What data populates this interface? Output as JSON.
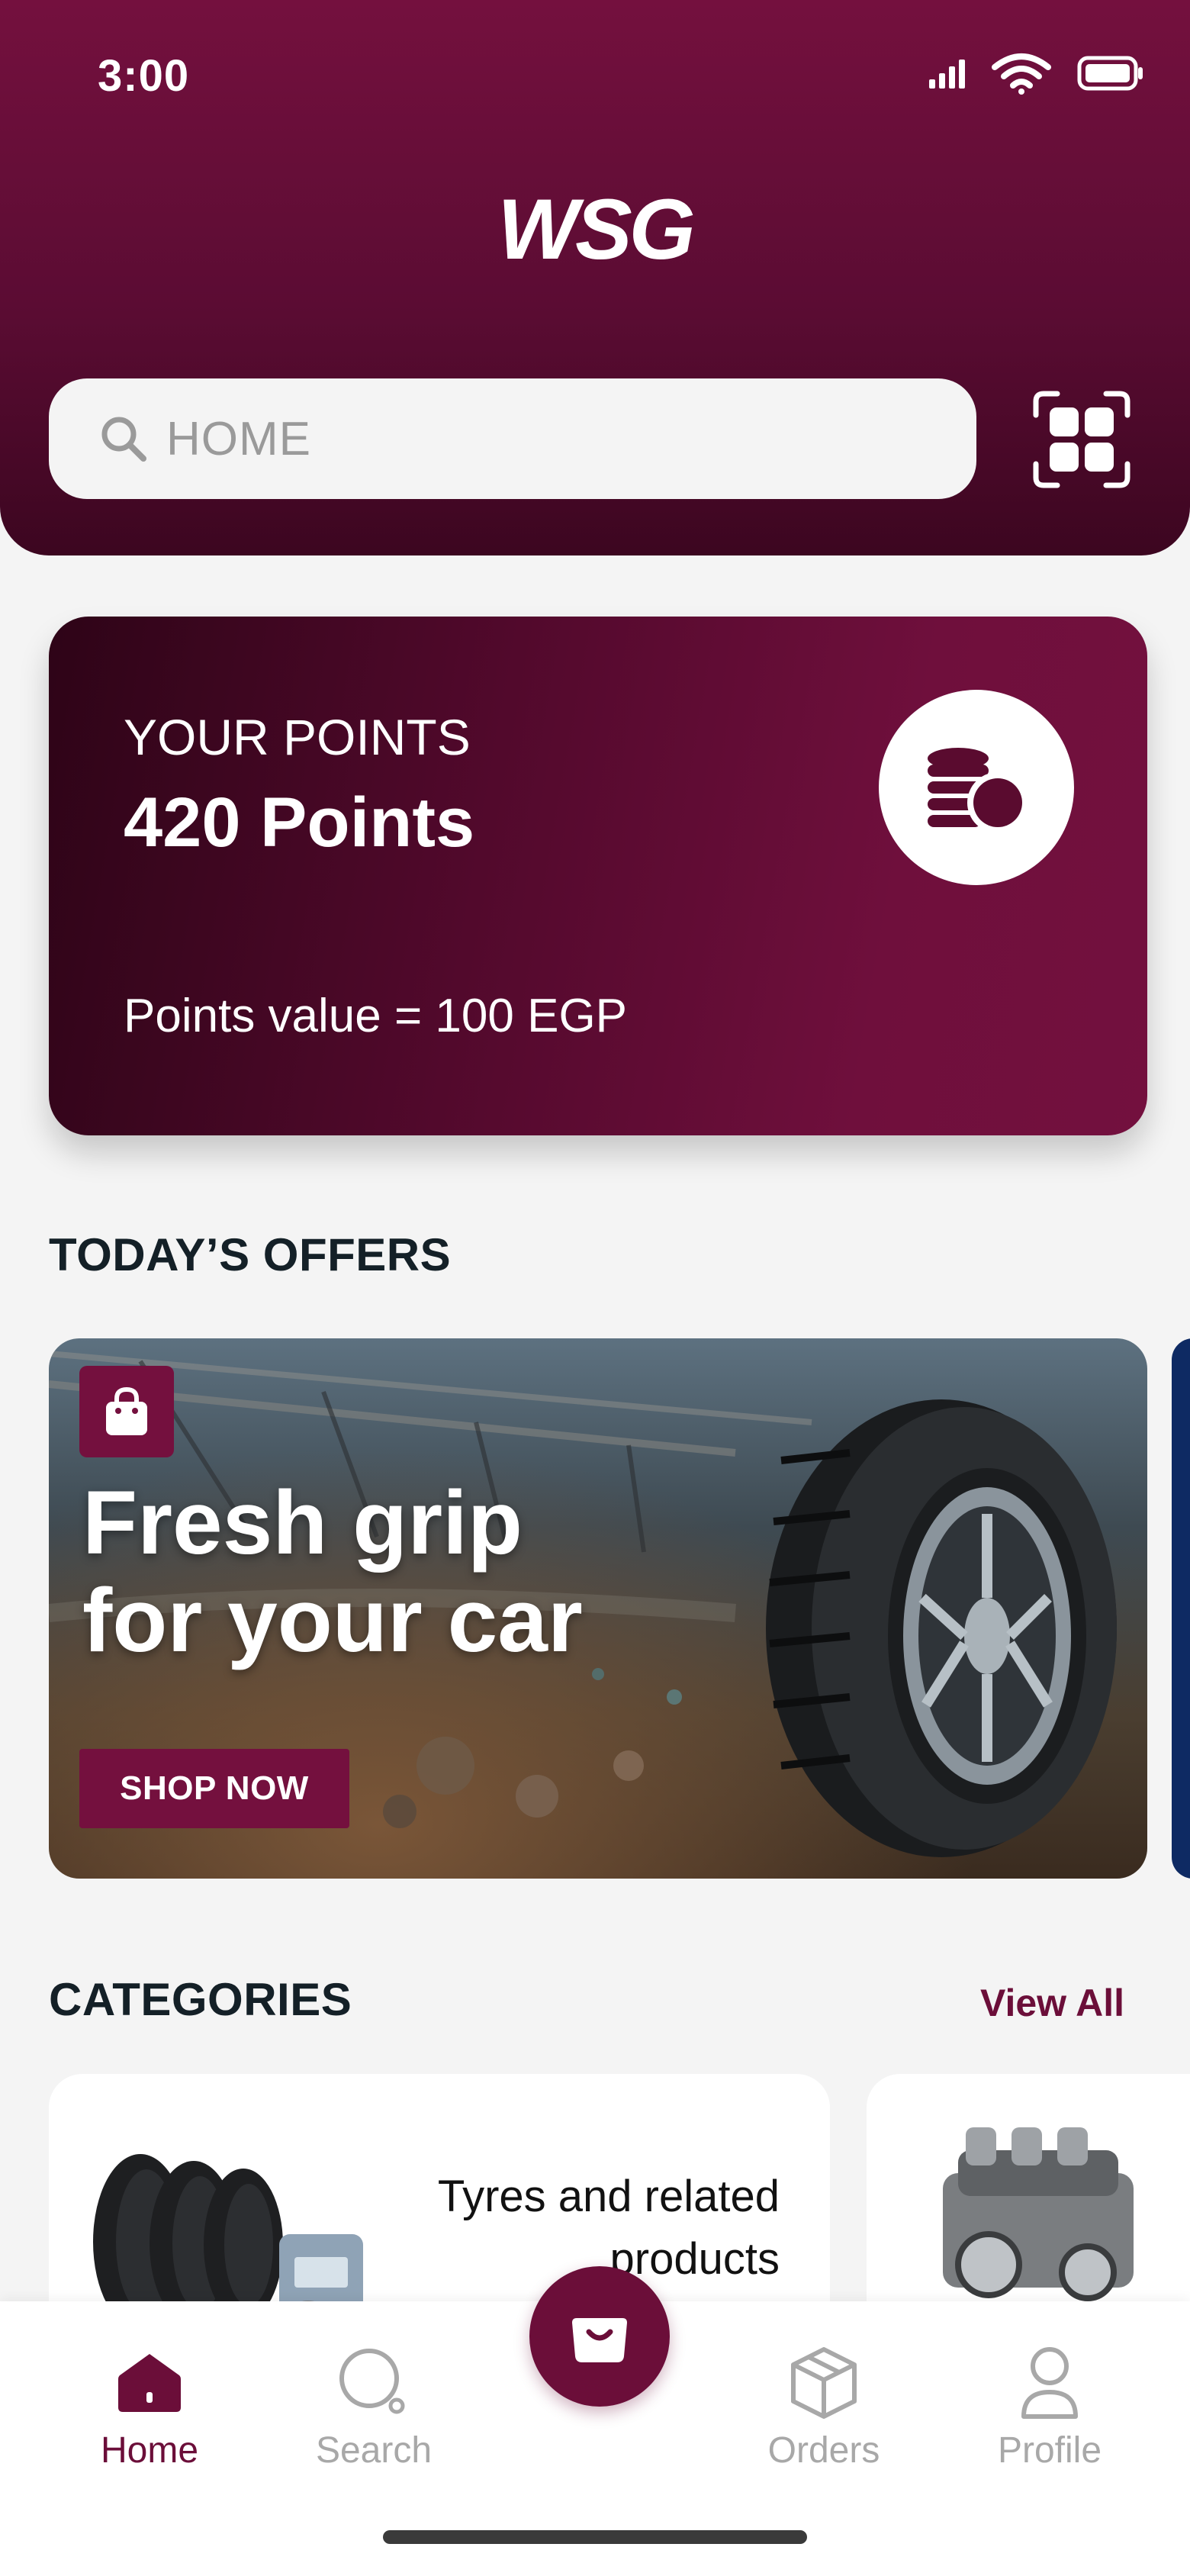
{
  "status_bar": {
    "time": "3:00",
    "icons": [
      "signal-icon",
      "wifi-icon",
      "battery-icon"
    ]
  },
  "header": {
    "logo_text": "WSG",
    "search": {
      "placeholder": "HOME",
      "icon": "search-icon"
    },
    "scan_icon": "qr-scan-icon"
  },
  "points_card": {
    "label": "YOUR POINTS",
    "value": "420 Points",
    "worth": "Points value = 100 EGP",
    "icon": "coins-icon"
  },
  "offers": {
    "title": "TODAY’S OFFERS",
    "banner": {
      "headline_line1": "Fresh grip",
      "headline_line2": "for your car",
      "cta": "SHOP NOW",
      "badge_icon": "shopping-bag-icon"
    }
  },
  "categories": {
    "title": "CATEGORIES",
    "view_all": "View All",
    "items": [
      {
        "label": "Tyres and related products"
      },
      {
        "label": ""
      }
    ]
  },
  "bottom_nav": {
    "items": [
      {
        "label": "Home",
        "icon": "home-icon",
        "active": true
      },
      {
        "label": "Search",
        "icon": "search-icon",
        "active": false
      },
      {
        "label": "Orders",
        "icon": "box-icon",
        "active": false
      },
      {
        "label": "Profile",
        "icon": "user-icon",
        "active": false
      }
    ],
    "fab_icon": "cart-bag-icon"
  },
  "colors": {
    "brand": "#74103e",
    "brand_dark": "#3c0620",
    "background": "#f4f4f4",
    "inactive": "#a8a8a8"
  }
}
